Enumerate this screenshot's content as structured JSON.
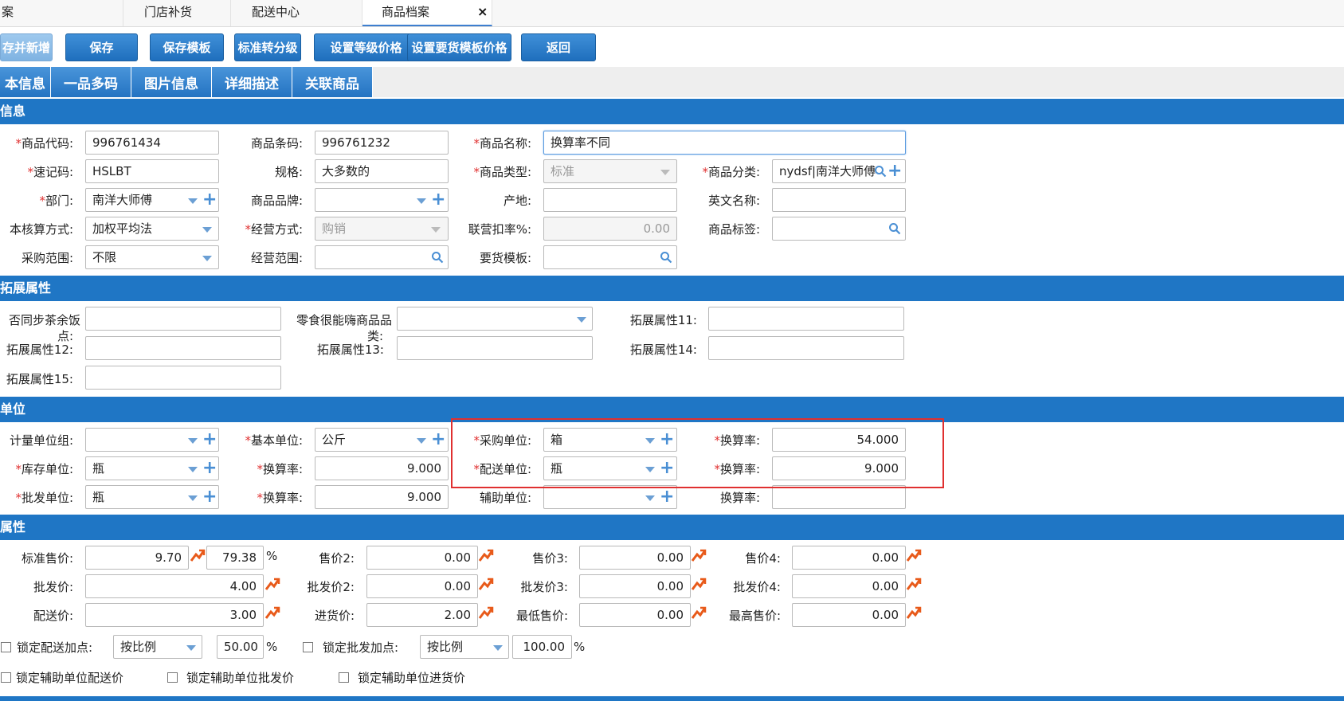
{
  "tabs": [
    "案",
    "门店补货",
    "配送中心",
    "商品档案"
  ],
  "toolbar": [
    "存并新增",
    "保存",
    "保存模板",
    "标准转分级",
    "设置等级价格",
    "设置要货模板价格",
    "返回"
  ],
  "subtabs": [
    "本信息",
    "一品多码",
    "图片信息",
    "详细描述",
    "关联商品"
  ],
  "sections": {
    "basic": "信息",
    "ext": "拓展属性",
    "unit": "单位",
    "attr": "属性"
  },
  "basic": {
    "code_label": "商品代码:",
    "code": "996761434",
    "barcode_label": "商品条码:",
    "barcode": "996761232",
    "name_label": "商品名称:",
    "name": "换算率不同",
    "mnemonic_label": "速记码:",
    "mnemonic": "HSLBT",
    "spec_label": "规格:",
    "spec": "大多数的",
    "type_label": "商品类型:",
    "type": "标准",
    "category_label": "商品分类:",
    "category": "nydsf|南洋大师傅",
    "dept_label": "部门:",
    "dept": "南洋大师傅",
    "brand_label": "商品品牌:",
    "brand": "",
    "origin_label": "产地:",
    "origin": "",
    "english_label": "英文名称:",
    "english": "",
    "cost_label": "本核算方式:",
    "cost": "加权平均法",
    "mode_label": "经营方式:",
    "mode": "购销",
    "rate_label": "联营扣率%:",
    "rate": "0.00",
    "tag_label": "商品标签:",
    "tag": "",
    "purchase_label": "采购范围:",
    "purchase": "不限",
    "scope_label": "经营范围:",
    "scope": "",
    "template_label": "要货模板:",
    "template": ""
  },
  "ext": {
    "l1a": "否同步茶余饭",
    "l1b": "点:",
    "l2a": "零食很能嗨商品品",
    "l2b": "类:",
    "l11": "拓展属性11:",
    "l12": "拓展属性12:",
    "l13": "拓展属性13:",
    "l14": "拓展属性14:",
    "l15": "拓展属性15:"
  },
  "unit": {
    "group_label": "计量单位组:",
    "group": "",
    "base_label": "基本单位:",
    "base": "公斤",
    "purchase_label": "采购单位:",
    "purchase": "箱",
    "ratio_label": "换算率:",
    "purchase_ratio": "54.000",
    "stock_label": "库存单位:",
    "stock": "瓶",
    "stock_ratio": "9.000",
    "dist_label": "配送单位:",
    "dist": "瓶",
    "dist_ratio": "9.000",
    "whole_label": "批发单位:",
    "whole": "瓶",
    "whole_ratio": "9.000",
    "aux_label": "辅助单位:",
    "aux": "",
    "aux_ratio": ""
  },
  "attr": {
    "std_label": "标准售价:",
    "std": "9.70",
    "std_pct": "79.38",
    "p2_label": "售价2:",
    "p2": "0.00",
    "p3_label": "售价3:",
    "p3": "0.00",
    "p4_label": "售价4:",
    "p4": "0.00",
    "w_label": "批发价:",
    "w": "4.00",
    "w2_label": "批发价2:",
    "w2": "0.00",
    "w3_label": "批发价3:",
    "w3": "0.00",
    "w4_label": "批发价4:",
    "w4": "0.00",
    "d_label": "配送价:",
    "d": "3.00",
    "in_label": "进货价:",
    "in": "2.00",
    "min_label": "最低售价:",
    "min": "0.00",
    "max_label": "最高售价:",
    "max": "0.00",
    "lock_dist": "锁定配送加点:",
    "lock_dist_mode": "按比例",
    "lock_dist_val": "50.00",
    "lock_whole": "锁定批发加点:",
    "lock_whole_mode": "按比例",
    "lock_whole_val": "100.00",
    "lock_aux_dist": "锁定辅助单位配送价",
    "lock_aux_whole": "锁定辅助单位批发价",
    "lock_aux_in": "锁定辅助单位进货价",
    "percent": "%"
  },
  "close_symbol": "×"
}
